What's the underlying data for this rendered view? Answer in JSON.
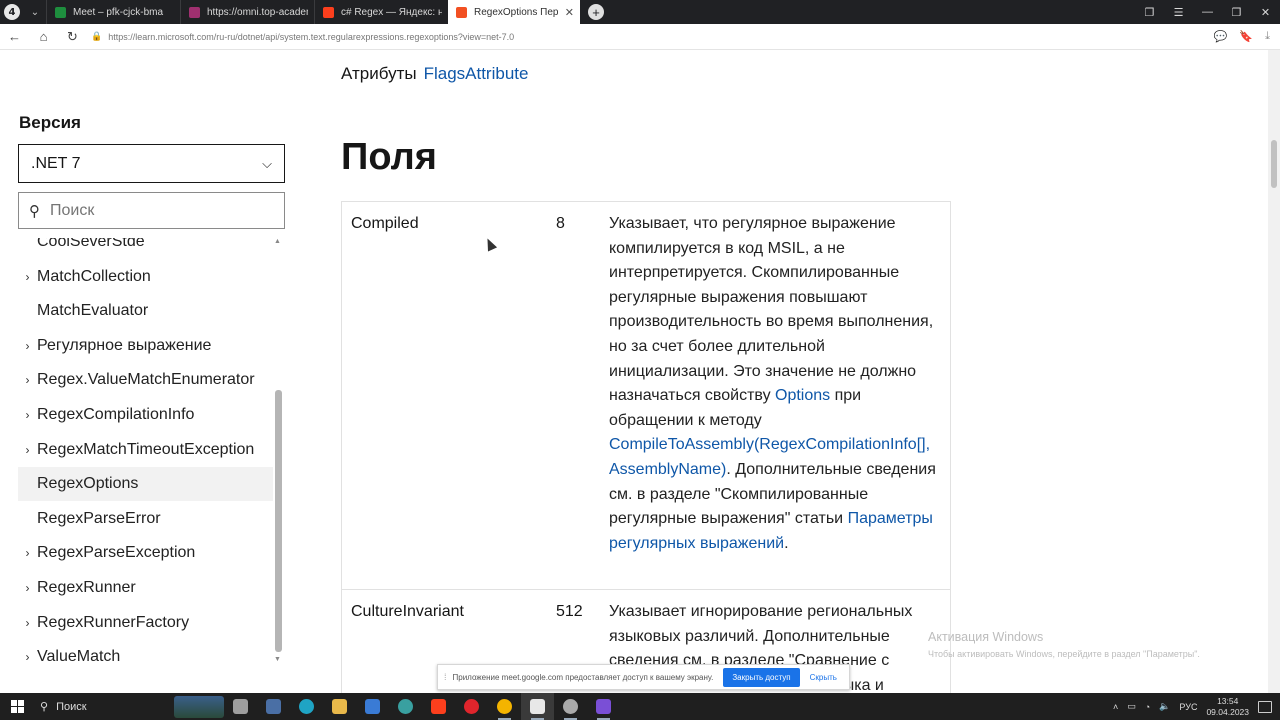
{
  "browser": {
    "tabs": [
      {
        "title": "Meet – pfk-cjck-bma",
        "favicon_color": "#1e8e3e",
        "active": false
      },
      {
        "title": "https://omni.top-academy",
        "favicon_color": "#a03070",
        "active": false
      },
      {
        "title": "c# Regex — Яндекс: нашл",
        "favicon_color": "#fc3f1d",
        "active": false
      },
      {
        "title": "RegexOptions Перечисл",
        "favicon_color": "#f25022",
        "active": true
      }
    ],
    "url": "https://learn.microsoft.com/ru-ru/dotnet/api/system.text.regularexpressions.regexoptions?view=net-7.0"
  },
  "article": {
    "attributes_label": "Атрибуты",
    "attributes_link": "FlagsAttribute",
    "fields_heading": "Поля"
  },
  "sidebar": {
    "version_title": "Версия",
    "version_value": ".NET 7",
    "search_placeholder": "Поиск",
    "items": [
      {
        "label": "CoolSeverStde",
        "expandable": false,
        "selected": false
      },
      {
        "label": "MatchCollection",
        "expandable": true,
        "selected": false
      },
      {
        "label": "MatchEvaluator",
        "expandable": false,
        "selected": false
      },
      {
        "label": "Регулярное выражение",
        "expandable": true,
        "selected": false
      },
      {
        "label": "Regex.ValueMatchEnumerator",
        "expandable": true,
        "selected": false
      },
      {
        "label": "RegexCompilationInfo",
        "expandable": true,
        "selected": false
      },
      {
        "label": "RegexMatchTimeoutException",
        "expandable": true,
        "selected": false
      },
      {
        "label": "RegexOptions",
        "expandable": false,
        "selected": true
      },
      {
        "label": "RegexParseError",
        "expandable": false,
        "selected": false
      },
      {
        "label": "RegexParseException",
        "expandable": true,
        "selected": false
      },
      {
        "label": "RegexRunner",
        "expandable": true,
        "selected": false
      },
      {
        "label": "RegexRunnerFactory",
        "expandable": true,
        "selected": false
      },
      {
        "label": "ValueMatch",
        "expandable": true,
        "selected": false
      }
    ]
  },
  "fields": [
    {
      "name": "Compiled",
      "value": "8",
      "desc_1": "Указывает, что регулярное выражение компилируется в код MSIL, а не интерпретируется. Скомпилированные регулярные выражения повышают производительность во время выполнения, но за счет более длительной инициализации. Это значение не должно назначаться свойству ",
      "link_1": "Options",
      "desc_2": " при обращении к методу ",
      "link_2": "CompileToAssembly(RegexCompilationInfo[], AssemblyName)",
      "desc_3": ". Дополнительные сведения см. в разделе \"Скомпилированные регулярные выражения\" статьи ",
      "link_3": "Параметры регулярных выражений",
      "desc_4": "."
    },
    {
      "name": "CultureInvariant",
      "value": "512",
      "desc_1": "Указывает игнорирование региональных языковых различий. Дополнительные сведения см. в разделе \"Сравнение с",
      "desc_2": "ого языка и"
    }
  ],
  "windows_activation": {
    "title": "Активация Windows",
    "subtitle": "Чтобы активировать Windows, перейдите в раздел \"Параметры\"."
  },
  "share_bar": {
    "message": "Приложение meet.google.com предоставляет доступ к вашему экрану.",
    "stop_label": "Закрыть доступ",
    "hide_label": "Скрыть"
  },
  "taskbar": {
    "search_label": "Поиск",
    "language": "РУС",
    "time": "13:54",
    "date": "09.04.2023",
    "apps": [
      {
        "name": "task-view",
        "color": "#9e9e9e",
        "open": false
      },
      {
        "name": "notepad",
        "color": "#4a6fa5",
        "open": false
      },
      {
        "name": "edge",
        "color": "#1fa4c4",
        "open": false
      },
      {
        "name": "explorer",
        "color": "#e8b84a",
        "open": false
      },
      {
        "name": "store",
        "color": "#3a7bd5",
        "open": false
      },
      {
        "name": "sync",
        "color": "#39a0a0",
        "open": false
      },
      {
        "name": "yandex",
        "color": "#fc3f1d",
        "open": false
      },
      {
        "name": "opera",
        "color": "#e0252c",
        "open": false
      },
      {
        "name": "chrome",
        "color": "#f4b400",
        "open": true
      },
      {
        "name": "yandex-browser",
        "color": "#e8e8e8",
        "open": true
      },
      {
        "name": "github",
        "color": "#aaaaaa",
        "open": true
      },
      {
        "name": "visual-studio",
        "color": "#7a4fd6",
        "open": true
      }
    ]
  }
}
